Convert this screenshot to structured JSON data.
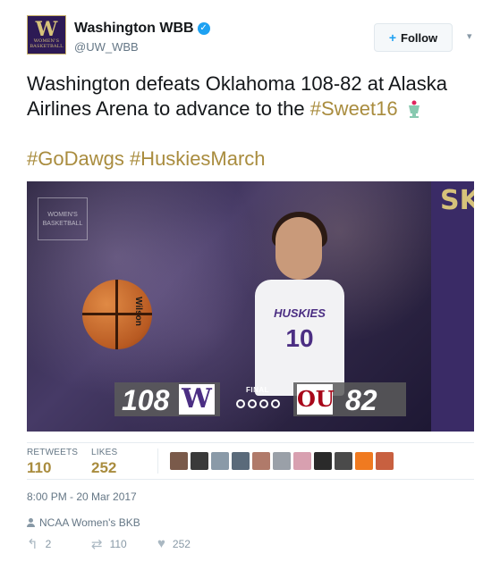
{
  "header": {
    "display_name": "Washington WBB",
    "handle": "@UW_WBB",
    "avatar_letter": "W",
    "avatar_subtext": "WOMEN'S BASKETBALL",
    "follow_label": "Follow"
  },
  "tweet": {
    "text_main": "Washington defeats Oklahoma 108-82 at Alaska Airlines Arena to advance to the ",
    "hashtag_sweet16": "#Sweet16",
    "hashtags_line": "#GoDawgs #HuskiesMarch"
  },
  "media": {
    "banner_text": "SKIES",
    "jersey_name": "HUSKIES",
    "jersey_number": "10",
    "ball_brand": "Wilson",
    "home_score": "108",
    "home_team_mark": "W",
    "status": "FINAL",
    "away_team_mark": "OU",
    "away_score": "82",
    "logo_mark_text": "WOMEN'S BASKETBALL"
  },
  "stats": {
    "retweets_label": "RETWEETS",
    "retweets_value": "110",
    "likes_label": "LIKES",
    "likes_value": "252",
    "liker_avatar_colors": [
      "#7a5a4a",
      "#3a3a3a",
      "#8a9aa8",
      "#5a6a7a",
      "#b07a6a",
      "#9aa0a8",
      "#d8a0b0",
      "#2a2a2a",
      "#4a4a4a",
      "#f07a20",
      "#c86040"
    ]
  },
  "meta": {
    "timestamp": "8:00 PM - 20 Mar 2017",
    "location": "NCAA Women's BKB"
  },
  "actions": {
    "reply_count": "2",
    "retweet_count": "110",
    "like_count": "252"
  }
}
